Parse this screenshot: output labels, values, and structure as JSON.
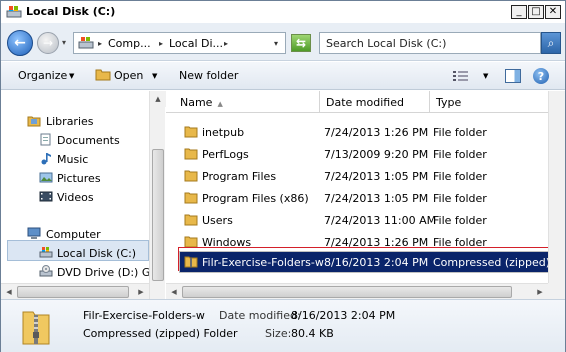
{
  "window": {
    "title": "Local Disk (C:)",
    "minimize_glyph": "_",
    "maximize_glyph": "□",
    "close_glyph": "✕"
  },
  "address": {
    "crumbs": [
      "Comp...",
      "Local Di..."
    ],
    "crumb_sep": "▸",
    "dropdown_glyph": "▾",
    "search_placeholder": "Search Local Disk (C:)"
  },
  "toolbar": {
    "organize": "Organize",
    "open": "Open",
    "new_folder": "New folder",
    "caret": "▼",
    "help_glyph": "?"
  },
  "nav": {
    "libraries": "Libraries",
    "documents": "Documents",
    "music": "Music",
    "pictures": "Pictures",
    "videos": "Videos",
    "computer": "Computer",
    "local_disk": "Local Disk (C:)",
    "dvd_drive": "DVD Drive (D:) GRN"
  },
  "columns": {
    "name": "Name",
    "sort_glyph": "▲",
    "date_modified": "Date modified",
    "type": "Type"
  },
  "files": [
    {
      "name": "inetpub",
      "date": "7/24/2013 1:26 PM",
      "type": "File folder"
    },
    {
      "name": "PerfLogs",
      "date": "7/13/2009 9:20 PM",
      "type": "File folder"
    },
    {
      "name": "Program Files",
      "date": "7/24/2013 1:05 PM",
      "type": "File folder"
    },
    {
      "name": "Program Files (x86)",
      "date": "7/24/2013 1:05 PM",
      "type": "File folder"
    },
    {
      "name": "Users",
      "date": "7/24/2013 11:00 AM",
      "type": "File folder"
    },
    {
      "name": "Windows",
      "date": "7/24/2013 1:26 PM",
      "type": "File folder"
    },
    {
      "name": "Filr-Exercise-Folders-w",
      "date": "8/16/2013 2:04 PM",
      "type": "Compressed (zipped) Folder"
    }
  ],
  "details": {
    "name": "Filr-Exercise-Folders-w",
    "type": "Compressed (zipped) Folder",
    "date_label": "Date modified:",
    "date_value": "8/16/2013 2:04 PM",
    "size_label": "Size:",
    "size_value": "80.4 KB"
  },
  "colors": {
    "selection": "#0a246a",
    "folder": "#e8b84a",
    "accent": "#1d5fb8"
  }
}
